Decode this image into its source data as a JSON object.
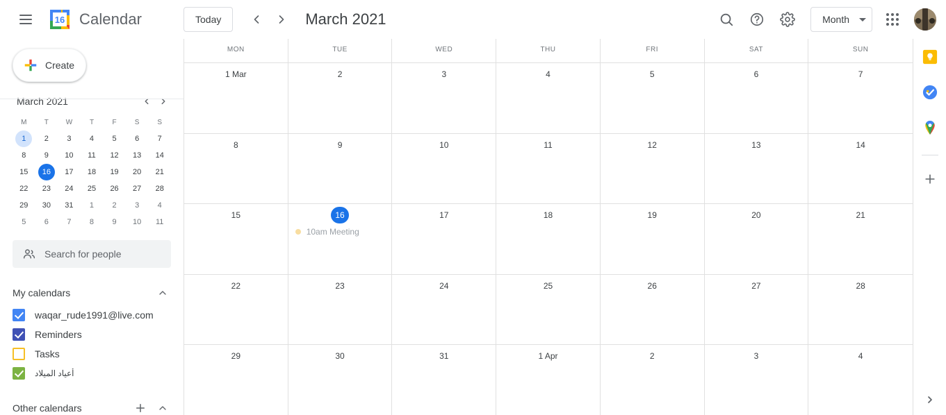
{
  "header": {
    "brand": "Calendar",
    "logo_day": "16",
    "today_label": "Today",
    "month_title": "March 2021",
    "view_label": "Month",
    "prev_icon": "chevron-left-icon",
    "next_icon": "chevron-right-icon",
    "search_icon": "search-icon",
    "help_icon": "help-icon",
    "settings_icon": "gear-icon",
    "apps_icon": "apps-grid-icon",
    "avatar_icon": "user-avatar"
  },
  "sidebar": {
    "create_label": "Create",
    "mini_calendar": {
      "title": "March 2021",
      "dow": [
        "M",
        "T",
        "W",
        "T",
        "F",
        "S",
        "S"
      ],
      "weeks": [
        [
          {
            "n": "1",
            "state": "sel"
          },
          {
            "n": "2",
            "state": ""
          },
          {
            "n": "3",
            "state": ""
          },
          {
            "n": "4",
            "state": ""
          },
          {
            "n": "5",
            "state": ""
          },
          {
            "n": "6",
            "state": ""
          },
          {
            "n": "7",
            "state": ""
          }
        ],
        [
          {
            "n": "8",
            "state": ""
          },
          {
            "n": "9",
            "state": ""
          },
          {
            "n": "10",
            "state": ""
          },
          {
            "n": "11",
            "state": ""
          },
          {
            "n": "12",
            "state": ""
          },
          {
            "n": "13",
            "state": ""
          },
          {
            "n": "14",
            "state": ""
          }
        ],
        [
          {
            "n": "15",
            "state": ""
          },
          {
            "n": "16",
            "state": "today"
          },
          {
            "n": "17",
            "state": ""
          },
          {
            "n": "18",
            "state": ""
          },
          {
            "n": "19",
            "state": ""
          },
          {
            "n": "20",
            "state": ""
          },
          {
            "n": "21",
            "state": ""
          }
        ],
        [
          {
            "n": "22",
            "state": ""
          },
          {
            "n": "23",
            "state": ""
          },
          {
            "n": "24",
            "state": ""
          },
          {
            "n": "25",
            "state": ""
          },
          {
            "n": "26",
            "state": ""
          },
          {
            "n": "27",
            "state": ""
          },
          {
            "n": "28",
            "state": ""
          }
        ],
        [
          {
            "n": "29",
            "state": ""
          },
          {
            "n": "30",
            "state": ""
          },
          {
            "n": "31",
            "state": ""
          },
          {
            "n": "1",
            "state": "other"
          },
          {
            "n": "2",
            "state": "other"
          },
          {
            "n": "3",
            "state": "other"
          },
          {
            "n": "4",
            "state": "other"
          }
        ],
        [
          {
            "n": "5",
            "state": "other"
          },
          {
            "n": "6",
            "state": "other"
          },
          {
            "n": "7",
            "state": "other"
          },
          {
            "n": "8",
            "state": "other"
          },
          {
            "n": "9",
            "state": "other"
          },
          {
            "n": "10",
            "state": "other"
          },
          {
            "n": "11",
            "state": "other"
          }
        ]
      ]
    },
    "search_people_placeholder": "Search for people",
    "my_calendars": {
      "title": "My calendars",
      "collapse_icon": "chevron-up-icon",
      "items": [
        {
          "label": "waqar_rude1991@live.com",
          "checked": true,
          "color": "#4285f4",
          "rtl": false
        },
        {
          "label": "Reminders",
          "checked": true,
          "color": "#3f51b5",
          "rtl": false
        },
        {
          "label": "Tasks",
          "checked": false,
          "color": "#f6bf26",
          "rtl": false
        },
        {
          "label": "أعياد الميلاد",
          "checked": true,
          "color": "#7cb342",
          "rtl": true
        }
      ]
    },
    "other_calendars": {
      "title": "Other calendars",
      "add_icon": "plus-icon",
      "collapse_icon": "chevron-up-icon"
    }
  },
  "calendar": {
    "day_headers": [
      "MON",
      "TUE",
      "WED",
      "THU",
      "FRI",
      "SAT",
      "SUN"
    ],
    "weeks": [
      [
        {
          "label": "1 Mar",
          "today": false,
          "events": []
        },
        {
          "label": "2",
          "today": false,
          "events": []
        },
        {
          "label": "3",
          "today": false,
          "events": []
        },
        {
          "label": "4",
          "today": false,
          "events": []
        },
        {
          "label": "5",
          "today": false,
          "events": []
        },
        {
          "label": "6",
          "today": false,
          "events": []
        },
        {
          "label": "7",
          "today": false,
          "events": []
        }
      ],
      [
        {
          "label": "8",
          "today": false,
          "events": []
        },
        {
          "label": "9",
          "today": false,
          "events": []
        },
        {
          "label": "10",
          "today": false,
          "events": []
        },
        {
          "label": "11",
          "today": false,
          "events": []
        },
        {
          "label": "12",
          "today": false,
          "events": []
        },
        {
          "label": "13",
          "today": false,
          "events": []
        },
        {
          "label": "14",
          "today": false,
          "events": []
        }
      ],
      [
        {
          "label": "15",
          "today": false,
          "events": []
        },
        {
          "label": "16",
          "today": true,
          "events": [
            {
              "title": "10am Meeting",
              "color": "#f8dda0"
            }
          ]
        },
        {
          "label": "17",
          "today": false,
          "events": []
        },
        {
          "label": "18",
          "today": false,
          "events": []
        },
        {
          "label": "19",
          "today": false,
          "events": []
        },
        {
          "label": "20",
          "today": false,
          "events": []
        },
        {
          "label": "21",
          "today": false,
          "events": []
        }
      ],
      [
        {
          "label": "22",
          "today": false,
          "events": []
        },
        {
          "label": "23",
          "today": false,
          "events": []
        },
        {
          "label": "24",
          "today": false,
          "events": []
        },
        {
          "label": "25",
          "today": false,
          "events": []
        },
        {
          "label": "26",
          "today": false,
          "events": []
        },
        {
          "label": "27",
          "today": false,
          "events": []
        },
        {
          "label": "28",
          "today": false,
          "events": []
        }
      ],
      [
        {
          "label": "29",
          "today": false,
          "events": []
        },
        {
          "label": "30",
          "today": false,
          "events": []
        },
        {
          "label": "31",
          "today": false,
          "events": []
        },
        {
          "label": "1 Apr",
          "today": false,
          "events": []
        },
        {
          "label": "2",
          "today": false,
          "events": []
        },
        {
          "label": "3",
          "today": false,
          "events": []
        },
        {
          "label": "4",
          "today": false,
          "events": []
        }
      ]
    ]
  },
  "rightbar": {
    "items": [
      {
        "name": "google-keep-icon"
      },
      {
        "name": "google-tasks-icon"
      },
      {
        "name": "google-maps-icon"
      }
    ],
    "add_icon": "plus-icon",
    "expand_icon": "chevron-right-icon"
  },
  "colors": {
    "accent": "#1a73e8",
    "today_badge": "#1a73e8",
    "selected_day": "#d2e3fc",
    "grid_line": "#e0e0e0"
  }
}
